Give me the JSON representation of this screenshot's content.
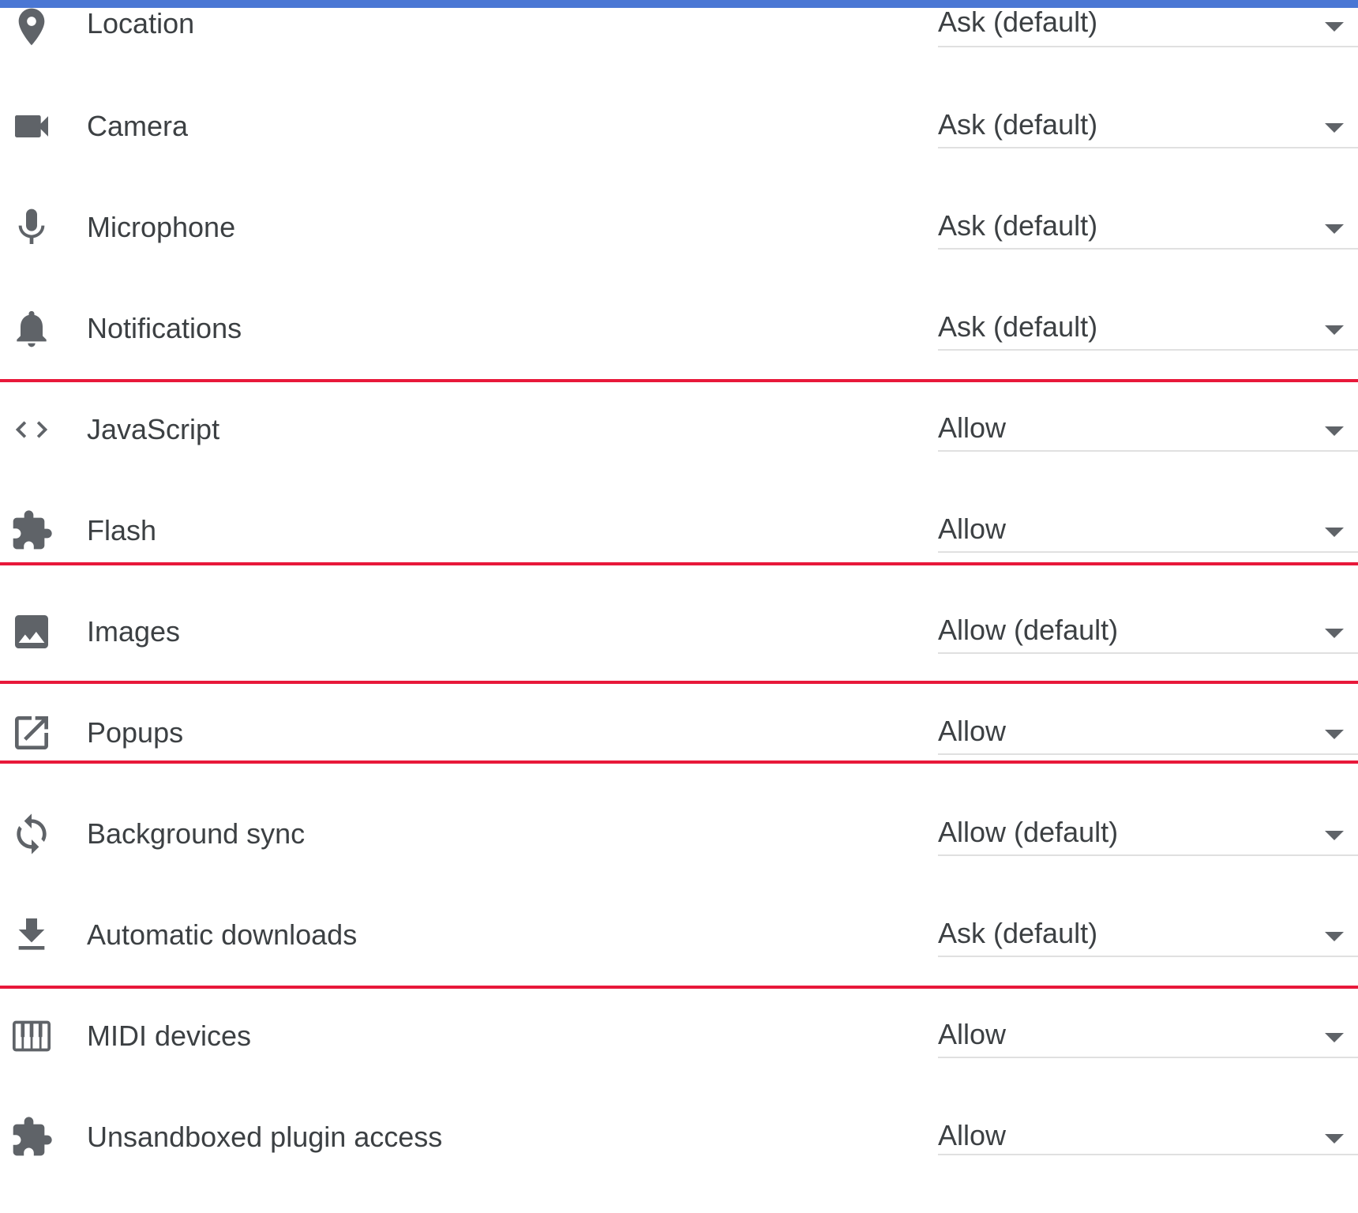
{
  "rows": [
    {
      "label": "Location",
      "value": "Ask (default)",
      "icon": "location-icon"
    },
    {
      "label": "Camera",
      "value": "Ask (default)",
      "icon": "camera-icon"
    },
    {
      "label": "Microphone",
      "value": "Ask (default)",
      "icon": "microphone-icon"
    },
    {
      "label": "Notifications",
      "value": "Ask (default)",
      "icon": "bell-icon"
    },
    {
      "label": "JavaScript",
      "value": "Allow",
      "icon": "code-icon"
    },
    {
      "label": "Flash",
      "value": "Allow",
      "icon": "puzzle-icon"
    },
    {
      "label": "Images",
      "value": "Allow (default)",
      "icon": "image-icon"
    },
    {
      "label": "Popups",
      "value": "Allow",
      "icon": "open-in-new-icon"
    },
    {
      "label": "Background sync",
      "value": "Allow (default)",
      "icon": "sync-icon"
    },
    {
      "label": "Automatic downloads",
      "value": "Ask (default)",
      "icon": "download-icon"
    },
    {
      "label": "MIDI devices",
      "value": "Allow",
      "icon": "piano-icon"
    },
    {
      "label": "Unsandboxed plugin access",
      "value": "Allow",
      "icon": "puzzle-icon"
    }
  ],
  "colors": {
    "top_bar": "#4a77d4",
    "highlight": "#e8183a",
    "icon": "#5f6368",
    "text": "#3c4043",
    "underline": "#e0e0e0"
  }
}
